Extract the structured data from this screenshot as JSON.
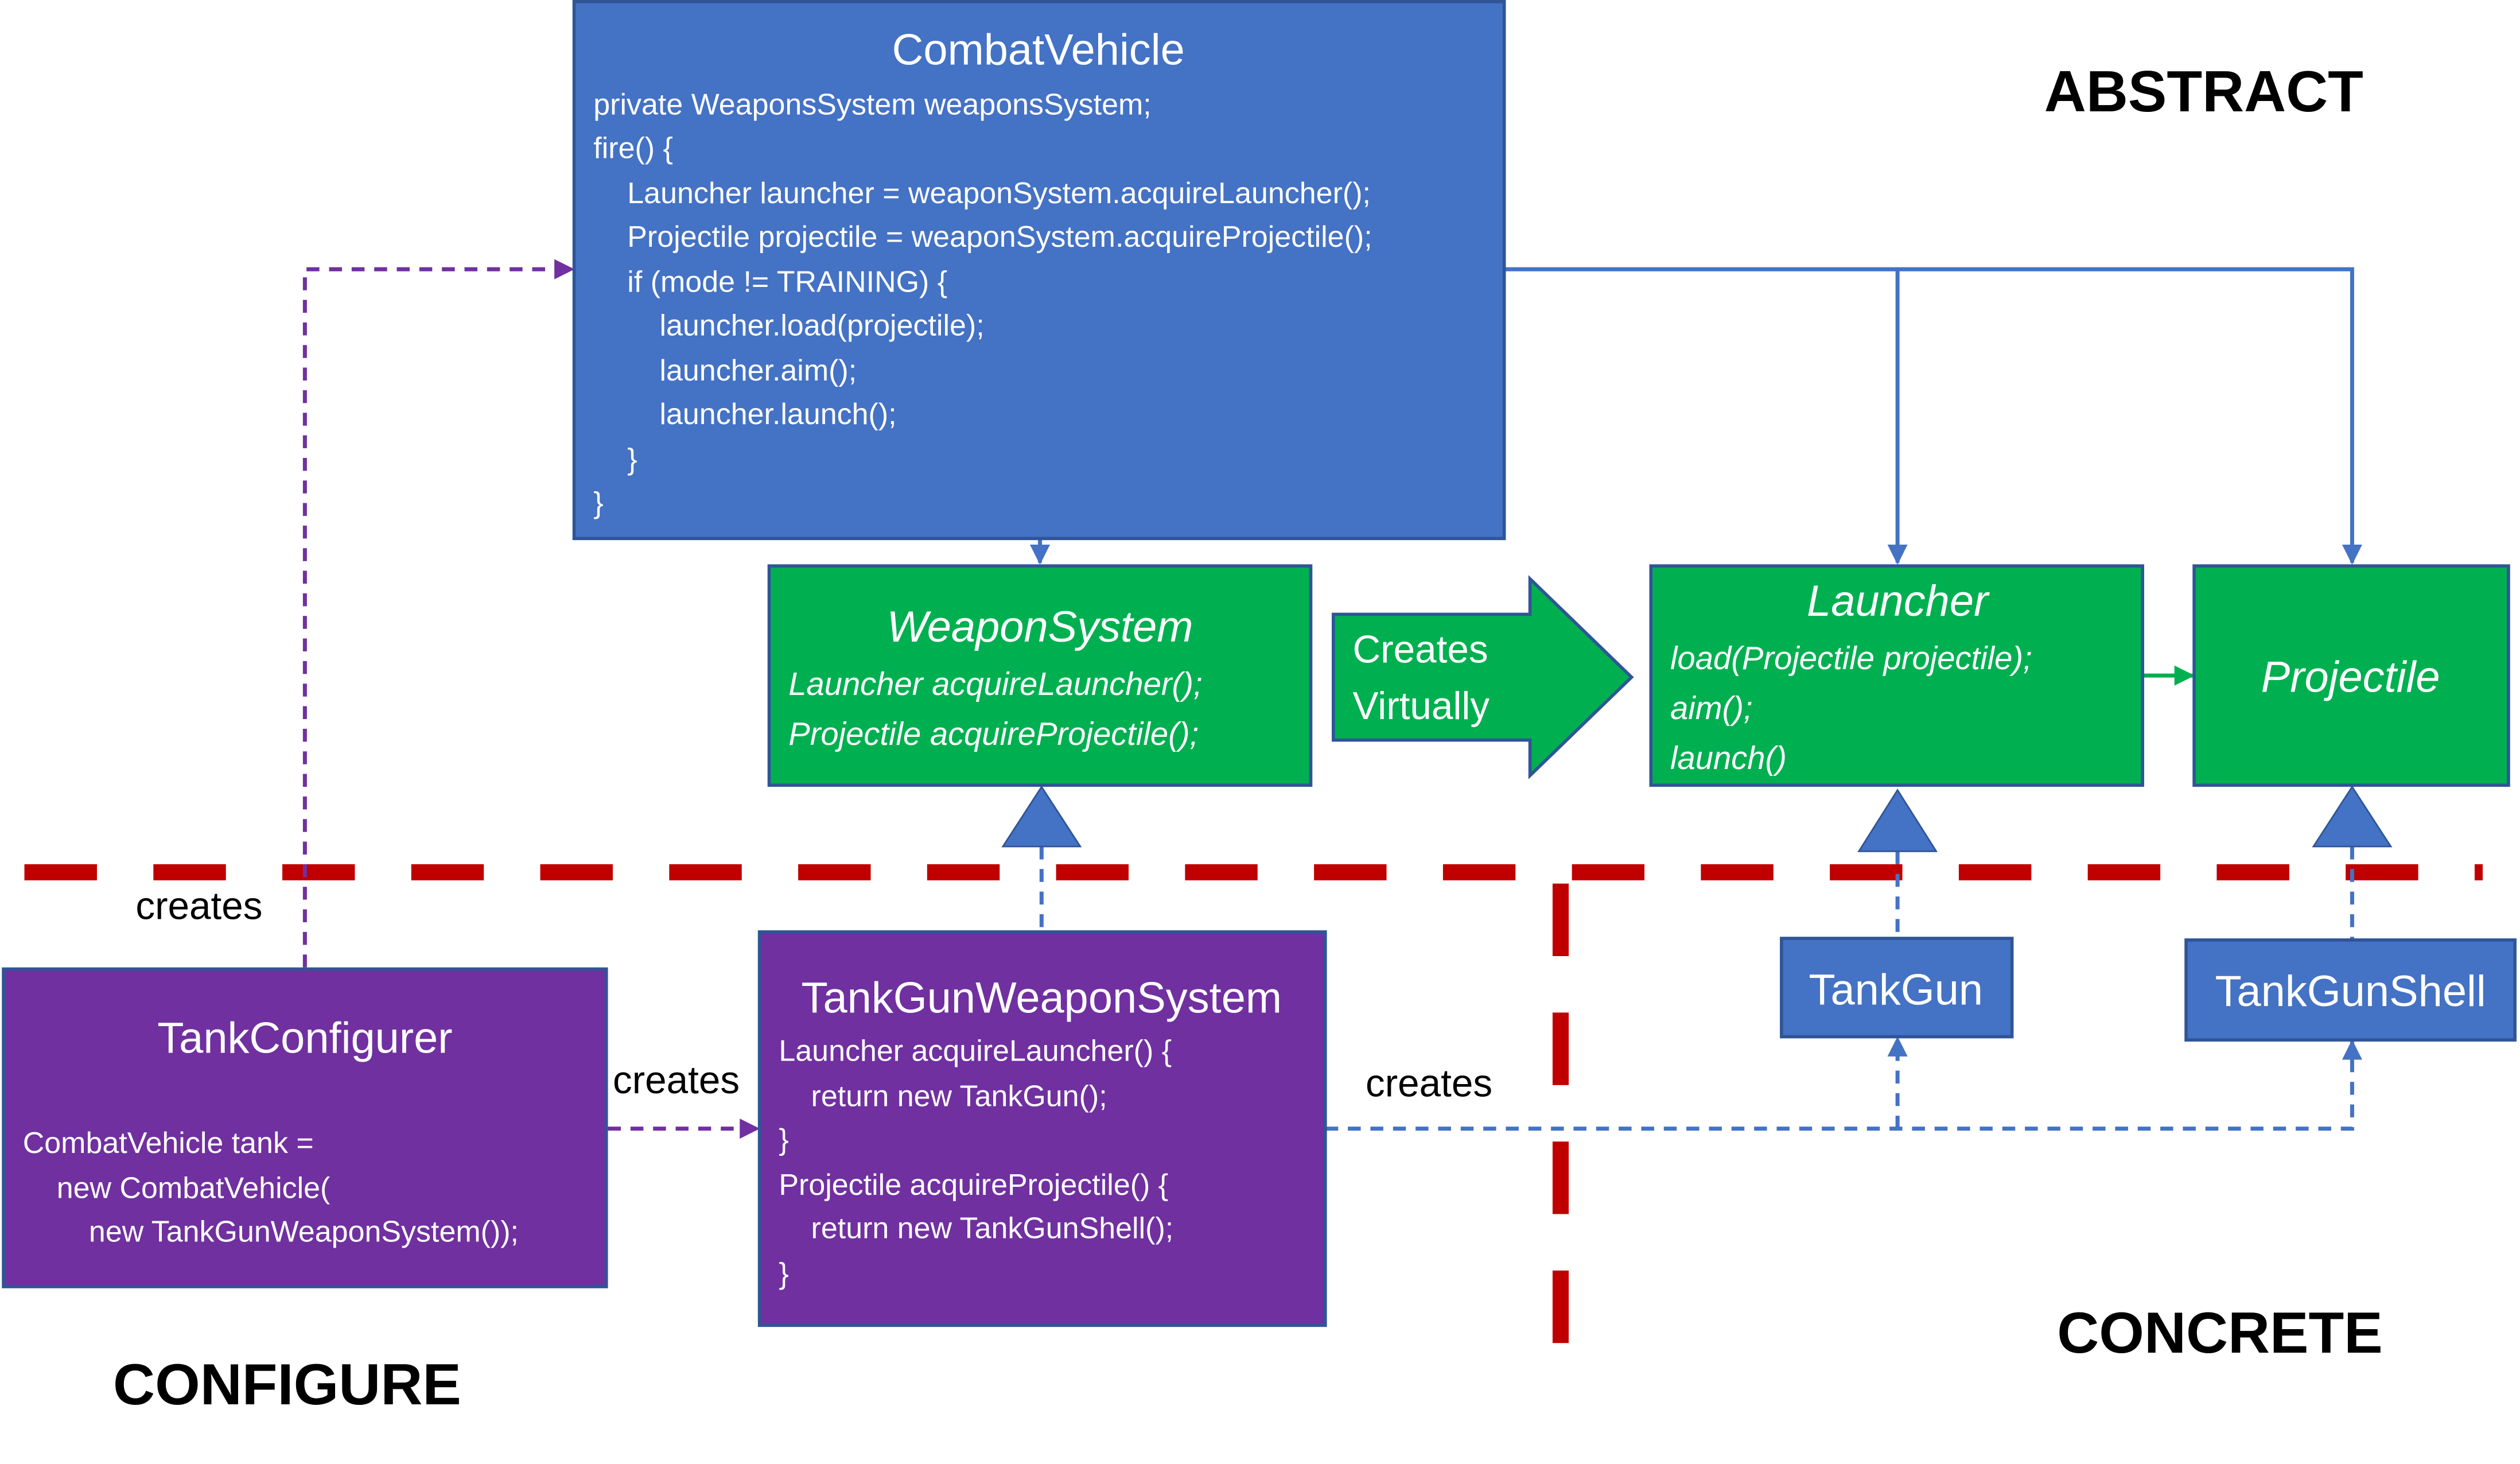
{
  "colors": {
    "abstract_class": "#4472C4",
    "interface": "#00B050",
    "concrete_config": "#7030A0",
    "boundary": "#C00000",
    "border": "#2F5597"
  },
  "labels": {
    "abstract": "ABSTRACT",
    "concrete": "CONCRETE",
    "configure": "CONFIGURE"
  },
  "combat_vehicle": {
    "title": "CombatVehicle",
    "lines": [
      "private  WeaponsSystem weaponsSystem;",
      "fire() {",
      "Launcher launcher = weaponSystem.acquireLauncher();",
      "Projectile projectile = weaponSystem.acquireProjectile();",
      "if (mode != TRAINING) {",
      "launcher.load(projectile);",
      "launcher.aim();",
      "launcher.launch();",
      "}",
      "}"
    ]
  },
  "weapon_system": {
    "title": "WeaponSystem",
    "lines": [
      "Launcher acquireLauncher();",
      "Projectile acquireProjectile();"
    ]
  },
  "creates_virtually": {
    "lines": [
      "Creates",
      "Virtually"
    ]
  },
  "launcher": {
    "title": "Launcher",
    "lines": [
      "load(Projectile projectile);",
      "aim();",
      "launch()"
    ]
  },
  "projectile": {
    "title": "Projectile"
  },
  "tank_gun": {
    "title": "TankGun"
  },
  "tank_gun_shell": {
    "title": "TankGunShell"
  },
  "tank_configurer": {
    "title": "TankConfigurer",
    "lines": [
      "CombatVehicle tank =",
      "new CombatVehicle(",
      "new TankGunWeaponSystem());"
    ]
  },
  "tank_gun_weapon_system": {
    "title": "TankGunWeaponSystem",
    "lines": [
      "Launcher acquireLauncher() {",
      "return new TankGun();",
      "}",
      "Projectile acquireProjectile() {",
      "return new TankGunShell();",
      "}"
    ]
  },
  "edges": {
    "creates_1": "creates",
    "creates_2": "creates",
    "creates_3": "creates"
  }
}
